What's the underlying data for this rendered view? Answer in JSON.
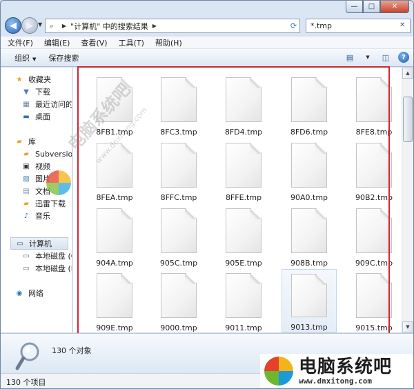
{
  "window": {
    "minimize_glyph": "—",
    "maximize_glyph": "□",
    "close_glyph": "✕"
  },
  "navbar": {
    "address_path": "\"计算机\" 中的搜索结果",
    "search_value": "*.tmp",
    "back_icon": "back-arrow-icon",
    "forward_icon": "forward-arrow-icon"
  },
  "menu": {
    "items": [
      "文件(F)",
      "编辑(E)",
      "查看(V)",
      "工具(T)",
      "帮助(H)"
    ]
  },
  "toolbar": {
    "organize_label": "组织",
    "save_search_label": "保存搜索"
  },
  "sidebar": {
    "favorites": {
      "label": "收藏夹",
      "items": [
        "下载",
        "最近访问的",
        "桌面"
      ]
    },
    "libraries": {
      "label": "库",
      "items": [
        "Subversion",
        "视频",
        "图片",
        "文档",
        "迅雷下载",
        "音乐"
      ]
    },
    "computer": {
      "label": "计算机",
      "items": [
        "本地磁盘 (C",
        "本地磁盘 (D"
      ]
    },
    "network": {
      "label": "网络"
    }
  },
  "files": [
    "8FB1.tmp",
    "8FC3.tmp",
    "8FD4.tmp",
    "8FD6.tmp",
    "8FE8.tmp",
    "8FEA.tmp",
    "8FFC.tmp",
    "8FFE.tmp",
    "90A0.tmp",
    "90B2.tmp",
    "904A.tmp",
    "905C.tmp",
    "905E.tmp",
    "908B.tmp",
    "909C.tmp",
    "909E.tmp",
    "9000.tmp",
    "9011.tmp",
    "9013.tmp",
    "9015.tmp"
  ],
  "selected_file_index": 18,
  "details": {
    "count_text": "130 个对象"
  },
  "status": {
    "text": "130 个项目"
  },
  "watermark": {
    "text": "电脑系统吧",
    "url": "www.dnxitong.com"
  },
  "brand": {
    "name": "电脑系统吧",
    "url": "www.dnxitong.com"
  },
  "colors": {
    "highlight_border": "#d9232e",
    "accent": "#2866b7"
  }
}
